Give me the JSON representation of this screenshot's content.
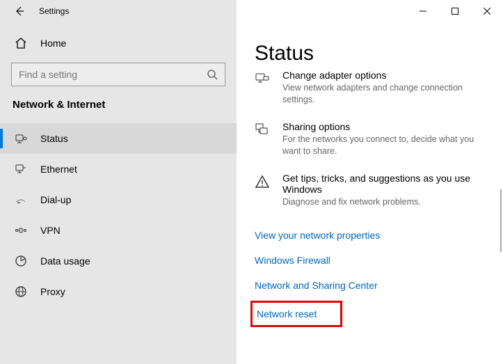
{
  "window": {
    "title": "Settings"
  },
  "sidebar": {
    "home_label": "Home",
    "search_placeholder": "Find a setting",
    "category": "Network & Internet",
    "items": [
      {
        "label": "Status"
      },
      {
        "label": "Ethernet"
      },
      {
        "label": "Dial-up"
      },
      {
        "label": "VPN"
      },
      {
        "label": "Data usage"
      },
      {
        "label": "Proxy"
      }
    ]
  },
  "content": {
    "heading": "Status",
    "settings": [
      {
        "title": "Change adapter options",
        "desc": "View network adapters and change connection settings."
      },
      {
        "title": "Sharing options",
        "desc": "For the networks you connect to, decide what you want to share."
      },
      {
        "title": "Get tips, tricks, and suggestions as you use Windows",
        "desc": "Diagnose and fix network problems."
      }
    ],
    "links": [
      "View your network properties",
      "Windows Firewall",
      "Network and Sharing Center",
      "Network reset"
    ]
  }
}
